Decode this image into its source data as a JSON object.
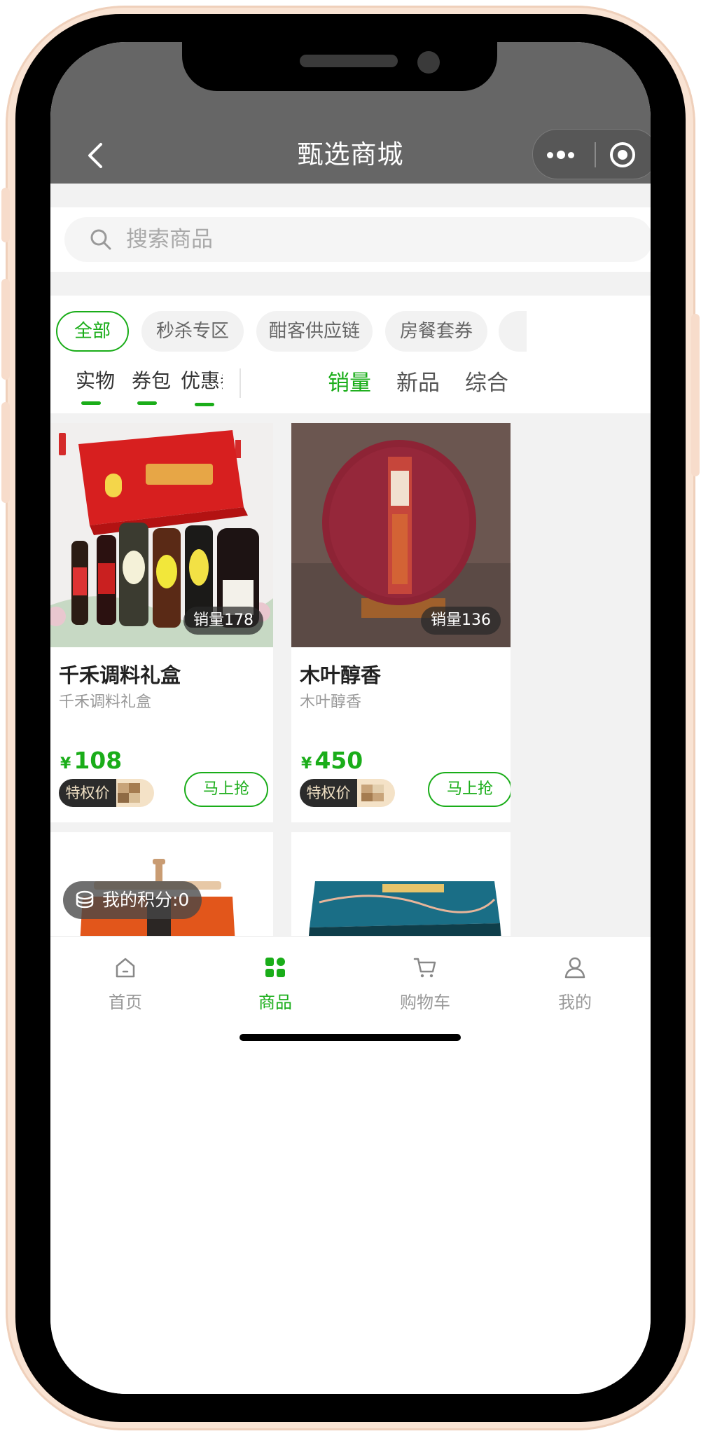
{
  "header": {
    "title": "甄选商城"
  },
  "search": {
    "placeholder": "搜索商品"
  },
  "categories": [
    "全部",
    "秒杀专区",
    "酣客供应链",
    "房餐套券"
  ],
  "type_tabs": [
    "实物",
    "券包",
    "优惠券"
  ],
  "sort_tabs": [
    "销量",
    "新品",
    "综合"
  ],
  "products": [
    {
      "name": "千禾调料礼盒",
      "subtitle": "千禾调料礼盒",
      "price_symbol": "¥",
      "price": "108",
      "sales": "销量178",
      "privilege": "特权价",
      "buy": "马上抢"
    },
    {
      "name": "木叶醇香",
      "subtitle": "木叶醇香",
      "price_symbol": "¥",
      "price": "450",
      "sales": "销量136",
      "privilege": "特权价",
      "buy": "马上抢"
    }
  ],
  "points": {
    "label": "我的积分:0"
  },
  "tabbar": [
    "首页",
    "商品",
    "购物车",
    "我的"
  ],
  "colors": {
    "accent": "#1aad19",
    "header": "#666666"
  }
}
